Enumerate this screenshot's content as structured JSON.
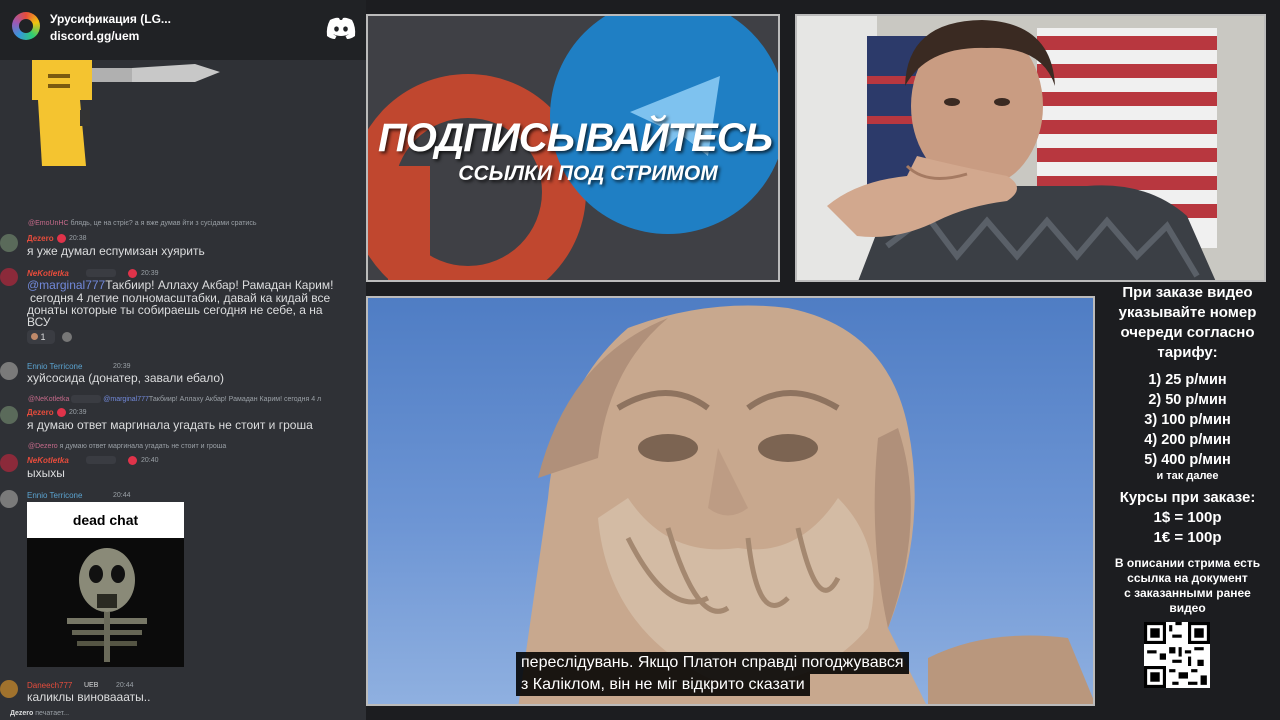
{
  "discord": {
    "server_name": "Урусификация (LG...",
    "invite": "discord.gg/uem",
    "typing": {
      "user": "Дezero",
      "text": "печатает..."
    }
  },
  "messages": [
    {
      "reply_to": "@EmoUnHC",
      "reply_text": "блядь, це на стріє? а я вже думав йти з сусідами сратись",
      "user": "Дezero",
      "user_color": "#e74c3c",
      "time": "20:38",
      "lines": [
        "я уже думал еспумизан хуярить"
      ]
    },
    {
      "user": "NeKotletka",
      "user_color": "#e74c3c",
      "time": "20:39",
      "mention": "@marginal777",
      "lines": [
        "Такбиир! Аллаху Акбар! Рамадан Карим!",
        "сегодня 4 летие полномасштабки, давай ка кидай все",
        "донаты которые ты собираешь сегодня не себе, а на",
        "ВСУ"
      ],
      "reaction_count": "1"
    },
    {
      "user": "Ennio Terricone",
      "user_color": "#5ba3d0",
      "time": "20:39",
      "lines": [
        "хуйсосида (донатер, завали ебало)"
      ]
    },
    {
      "reply_to": "@NeKotletka",
      "reply_mention": "@marginal777",
      "reply_text": "Такбиир! Аллаху Акбар! Рамадан Карим! сегодня 4 л",
      "user": "Дezero",
      "user_color": "#e74c3c",
      "time": "20:39",
      "lines": [
        "я думаю ответ маргинала угадать не стоит и гроша"
      ]
    },
    {
      "reply_to": "@Dezero",
      "reply_text": "я думаю ответ маргинала угадать не стоит и гроша",
      "user": "NeKotletka",
      "user_color": "#e74c3c",
      "time": "20:40",
      "lines": [
        "ыхыхы"
      ]
    },
    {
      "user": "Ennio Terricone",
      "user_color": "#5ba3d0",
      "time": "20:44",
      "image_caption": "dead chat"
    },
    {
      "user": "Daneech777",
      "user_color": "#e74c3c",
      "tag": "UEB",
      "time": "20:44",
      "lines": [
        "каликлы виноваааты.."
      ]
    }
  ],
  "banner": {
    "line1": "ПОДПИСЫВАЙТЕСЬ",
    "line2": "ССЫЛКИ ПОД СТРИМОМ"
  },
  "subtitles": [
    "переслідувань. Якщо Платон справді погоджувався",
    "з Каліклом, він не міг відкрито сказати"
  ],
  "info": {
    "header": [
      "При заказе видео",
      "указывайте номер",
      "очереди согласно",
      "тарифу:"
    ],
    "prices": [
      "1) 25 р/мин",
      "2) 50 р/мин",
      "3) 100 р/мин",
      "4) 200 р/мин",
      "5) 400 р/мин"
    ],
    "etc": "и так далее",
    "rates_title": "Курсы при заказе:",
    "rates": [
      "1$ = 100р",
      "1€ = 100р"
    ],
    "note": [
      "В описании стрима есть",
      "ссылка на документ",
      "с заказанными ранее",
      "видео"
    ]
  },
  "colors": {
    "discord_bg": "#2f3136",
    "header_bg": "#202225",
    "mention": "#7289da",
    "page_bg": "#1c1d20"
  }
}
